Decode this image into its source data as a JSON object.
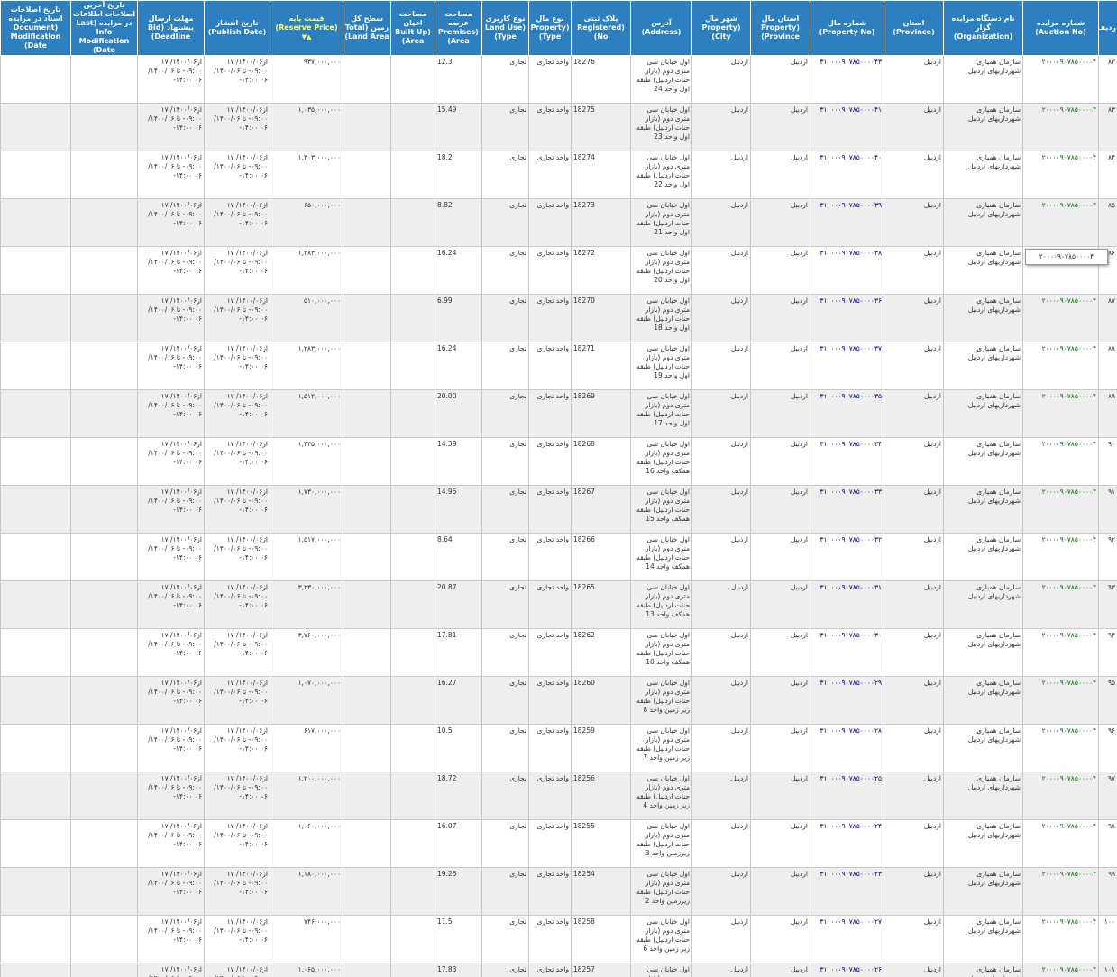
{
  "headers": {
    "row": "ردیف",
    "auction_no": "شماره مزایده (Auction No)",
    "organization": "نام دستگاه مزایده گزار (Organization)",
    "province": "استان (Province)",
    "property_no": "شماره مال (Property No)",
    "property_province": "استان مال (Property Province)",
    "property_city": "شهر مال (Property City)",
    "address": "آدرس (Address)",
    "registered_no": "پلاک ثبتی (Registered No)",
    "property_type": "نوع مال (Property Type)",
    "land_use": "نوع کاربری (Land Use Type)",
    "premises_area": "مساحت عرصه (Premises Area)",
    "built_up_area": "مساحت اعیان (Built Up Area)",
    "land_area": "سطح کل زمین (Total Land Area)",
    "reserve_price": "قیمت پایه (Reserve Price)",
    "publish_date": "تاریخ انتشار (Publish Date)",
    "bid_deadline": "مهلت ارسال پیشنهاد (Bid Deadline)",
    "last_info_mod": "تاریخ آخرین اصلاحات اطلاعات در مزایده (Last Info Modification Date)",
    "doc_mod": "تاریخ اصلاحات اسناد در مزایده (Document Modification Date)"
  },
  "sort_icon": "▲▼",
  "tooltip": "۲۰۰۰۰۹۰۷۸۵۰۰۰۰۴",
  "common": {
    "auction_no": "۲۰۰۰۰۹۰۷۸۵۰۰۰۰۴",
    "organization": "سازمان همیاری شهرداریهای اردبیل",
    "province": "اردبیل",
    "property_province": "اردبیل",
    "property_city": "اردبیل",
    "property_type": "واحد تجاری",
    "land_use": "تجاری",
    "publish_date": "از۱۴۰۰/۰۶/ ۱۷ ۰۹:۰۰- تا ۱۴۰۰/۰۶/ ۰۶ ۱۴:۰۰-",
    "bid_deadline": "از۱۴۰۰/۰۶/ ۱۷ ۰۹:۰۰- تا ۱۴۰۰/۰۶/ ۰۶ ۱۴:۰۰-"
  },
  "rows": [
    {
      "row": "۸۲",
      "property_no": "۳۱۰۰۰۰۹۰۷۸۵۰۰۰۰۴۳",
      "address": "اول خیابان سی متری دوم (بازار حنات اردبیل) طبقه اول واحد 24",
      "registered_no": "18276",
      "premises_area": "12.3",
      "reserve_price": "۹۳۷,۰۰۰,۰۰۰"
    },
    {
      "row": "۸۳",
      "property_no": "۳۱۰۰۰۰۹۰۷۸۵۰۰۰۰۴۱",
      "address": "اول خیابان سی متری دوم (بازار حنات اردبیل) طبقه اول واحد 23",
      "registered_no": "18275",
      "premises_area": "15.49",
      "reserve_price": "۱,۰۳۵,۰۰۰,۰۰۰"
    },
    {
      "row": "۸۴",
      "property_no": "۳۱۰۰۰۰۹۰۷۸۵۰۰۰۰۴۰",
      "address": "اول خیابان سی متری دوم (بازار حنات اردبیل) طبقه اول واحد 22",
      "registered_no": "18274",
      "premises_area": "18.2",
      "reserve_price": "۱,۳۰۳,۰۰۰,۰۰۰"
    },
    {
      "row": "۸۵",
      "property_no": "۳۱۰۰۰۰۹۰۷۸۵۰۰۰۰۳۹",
      "address": "اول خیابان سی متری دوم (بازار حنات اردبیل) طبقه اول واحد 21",
      "registered_no": "18273",
      "premises_area": "8.82",
      "reserve_price": "۶۵۰,۰۰۰,۰۰۰"
    },
    {
      "row": "۸۶",
      "property_no": "۳۱۰۰۰۰۹۰۷۸۵۰۰۰۰۳۸",
      "address": "اول خیابان سی متری دوم (بازار حنات اردبیل) طبقه اول واحد 20",
      "registered_no": "18272",
      "premises_area": "16.24",
      "reserve_price": "۱,۲۸۳,۰۰۰,۰۰۰"
    },
    {
      "row": "۸۷",
      "property_no": "۳۱۰۰۰۰۹۰۷۸۵۰۰۰۰۳۶",
      "address": "اول خیابان سی متری دوم (بازار حنات اردبیل) طبقه اول واحد 18",
      "registered_no": "18270",
      "premises_area": "6.99",
      "reserve_price": "۵۱۰,۰۰۰,۰۰۰"
    },
    {
      "row": "۸۸",
      "property_no": "۳۱۰۰۰۰۹۰۷۸۵۰۰۰۰۳۷",
      "address": "اول خیابان سی متری دوم (بازار حنات اردبیل) طبقه اول واحد 19",
      "registered_no": "18271",
      "premises_area": "16.24",
      "reserve_price": "۱,۲۸۳,۰۰۰,۰۰۰"
    },
    {
      "row": "۸۹",
      "property_no": "۳۱۰۰۰۰۹۰۷۸۵۰۰۰۰۳۵",
      "address": "اول خیابان سی متری دوم (بازار حنات اردبیل) طبقه اول واحد 17",
      "registered_no": "18269",
      "premises_area": "20.00",
      "reserve_price": "۱,۵۱۲,۰۰۰,۰۰۰"
    },
    {
      "row": "۹۰",
      "property_no": "۳۱۰۰۰۰۹۰۷۸۵۰۰۰۰۳۴",
      "address": "اول خیابان سی متری دوم (بازار حنات اردبیل) طبقه همکف واحد 16",
      "registered_no": "18268",
      "premises_area": "14.39",
      "reserve_price": "۱,۴۳۵,۰۰۰,۰۰۰"
    },
    {
      "row": "۹۱",
      "property_no": "۳۱۰۰۰۰۹۰۷۸۵۰۰۰۰۳۳",
      "address": "اول خیابان سی متری دوم (بازار حنات اردبیل) طبقه همکف واحد 15",
      "registered_no": "18267",
      "premises_area": "14.95",
      "reserve_price": "۱,۷۳۰,۰۰۰,۰۰۰"
    },
    {
      "row": "۹۲",
      "property_no": "۳۱۰۰۰۰۹۰۷۸۵۰۰۰۰۳۲",
      "address": "اول خیابان سی متری دوم (بازار حنات اردبیل) طبقه همکف واحد 14",
      "registered_no": "18266",
      "premises_area": "8.64",
      "reserve_price": "۱,۵۱۷,۰۰۰,۰۰۰"
    },
    {
      "row": "۹۳",
      "property_no": "۳۱۰۰۰۰۹۰۷۸۵۰۰۰۰۳۱",
      "address": "اول خیابان سی متری دوم (بازار حنات اردبیل) طبقه همکف واحد 13",
      "registered_no": "18265",
      "premises_area": "20.87",
      "reserve_price": "۳,۲۳۰,۰۰۰,۰۰۰"
    },
    {
      "row": "۹۴",
      "property_no": "۳۱۰۰۰۰۹۰۷۸۵۰۰۰۰۳۰",
      "address": "اول خیابان سی متری دوم (بازار حنات اردبیل) طبقه همکف واحد 10",
      "registered_no": "18262",
      "premises_area": "17.81",
      "reserve_price": "۳,۷۶۰,۰۰۰,۰۰۰"
    },
    {
      "row": "۹۵",
      "property_no": "۳۱۰۰۰۰۹۰۷۸۵۰۰۰۰۲۹",
      "address": "اول خیابان سی متری دوم (بازار حنات اردبیل) طبقه زیر زمین واحد 8",
      "registered_no": "18260",
      "premises_area": "16.27",
      "reserve_price": "۱,۰۷۰,۰۰۰,۰۰۰"
    },
    {
      "row": "۹۶",
      "property_no": "۳۱۰۰۰۰۹۰۷۸۵۰۰۰۰۲۸",
      "address": "اول خیابان سی متری دوم (بازار حنات اردبیل) طبقه زیر زمین واحد 7",
      "registered_no": "18259",
      "premises_area": "10.5",
      "reserve_price": "۶۱۷,۰۰۰,۰۰۰"
    },
    {
      "row": "۹۷",
      "property_no": "۳۱۰۰۰۰۹۰۷۸۵۰۰۰۰۲۵",
      "address": "اول خیابان سی متری دوم (بازار حنات اردبیل) طبقه زیر زمین واحد 4",
      "registered_no": "18256",
      "premises_area": "18.72",
      "reserve_price": "۱,۲۰۰,۰۰۰,۰۰۰"
    },
    {
      "row": "۹۸",
      "property_no": "۳۱۰۰۰۰۹۰۷۸۵۰۰۰۰۲۴",
      "address": "اول خیابان سی متری دوم (بازار حنات اردبیل) طبقه زیرزمین واحد 3",
      "registered_no": "18255",
      "premises_area": "16.07",
      "reserve_price": "۱,۰۶۰,۰۰۰,۰۰۰"
    },
    {
      "row": "۹۹",
      "property_no": "۳۱۰۰۰۰۹۰۷۸۵۰۰۰۰۲۳",
      "address": "اول خیابان سی متری دوم (بازار حنات اردبیل) طبقه زیرزمین واحد 2",
      "registered_no": "18254",
      "premises_area": "19.25",
      "reserve_price": "۱,۱۸۰,۰۰۰,۰۰۰"
    },
    {
      "row": "۱۰۰",
      "property_no": "۳۱۰۰۰۰۹۰۷۸۵۰۰۰۰۲۷",
      "address": "اول خیابان سی متری دوم (بازار حنات اردبیل) طبقه زیر زمین واحد 6",
      "registered_no": "18258",
      "premises_area": "11.5",
      "reserve_price": "۷۴۶,۰۰۰,۰۰۰"
    },
    {
      "row": "۱۰۱",
      "property_no": "۳۱۰۰۰۰۹۰۷۸۵۰۰۰۰۲۶",
      "address": "اول خیابان سی متری دوم (بازار حنات اردبیل) طبقه زیر زمین واحد 5",
      "registered_no": "18257",
      "premises_area": "17.83",
      "reserve_price": "۱,۰۶۵,۰۰۰,۰۰۰"
    }
  ]
}
